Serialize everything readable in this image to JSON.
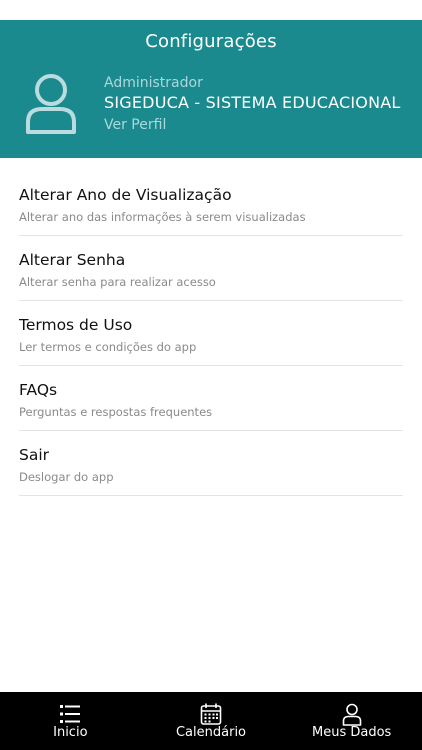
{
  "header": {
    "title": "Configurações"
  },
  "profile": {
    "role": "Administrador",
    "name": "SIGEDUCA - SISTEMA EDUCACIONAL",
    "link_label": "Ver Perfil",
    "avatar_icon": "user-icon"
  },
  "settings": {
    "items": [
      {
        "title": "Alterar Ano de Visualização",
        "subtitle": "Alterar ano das informações à serem visualizadas"
      },
      {
        "title": "Alterar Senha",
        "subtitle": "Alterar senha para realizar acesso"
      },
      {
        "title": "Termos de Uso",
        "subtitle": "Ler termos e condições do app"
      },
      {
        "title": "FAQs",
        "subtitle": "Perguntas e respostas frequentes"
      },
      {
        "title": "Sair",
        "subtitle": "Deslogar do app"
      }
    ]
  },
  "nav": {
    "items": [
      {
        "label": "Inicio",
        "icon": "list-icon"
      },
      {
        "label": "Calendário",
        "icon": "calendar-icon"
      },
      {
        "label": "Meus Dados",
        "icon": "user-icon"
      }
    ]
  },
  "colors": {
    "header_bg": "#1b8a8f",
    "nav_bg": "#000000",
    "muted_text": "#8a8a8a"
  }
}
